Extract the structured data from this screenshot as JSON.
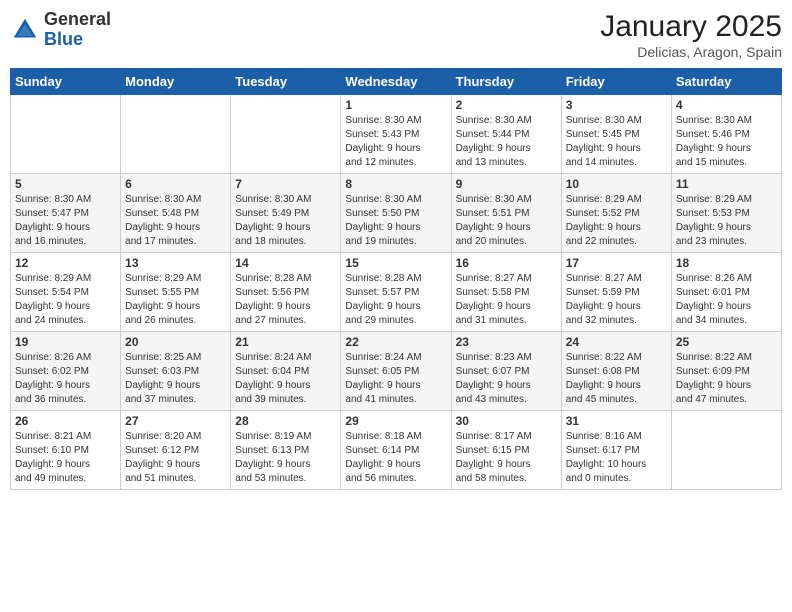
{
  "logo": {
    "general": "General",
    "blue": "Blue"
  },
  "title": "January 2025",
  "location": "Delicias, Aragon, Spain",
  "weekdays": [
    "Sunday",
    "Monday",
    "Tuesday",
    "Wednesday",
    "Thursday",
    "Friday",
    "Saturday"
  ],
  "weeks": [
    [
      {
        "day": "",
        "info": ""
      },
      {
        "day": "",
        "info": ""
      },
      {
        "day": "",
        "info": ""
      },
      {
        "day": "1",
        "info": "Sunrise: 8:30 AM\nSunset: 5:43 PM\nDaylight: 9 hours\nand 12 minutes."
      },
      {
        "day": "2",
        "info": "Sunrise: 8:30 AM\nSunset: 5:44 PM\nDaylight: 9 hours\nand 13 minutes."
      },
      {
        "day": "3",
        "info": "Sunrise: 8:30 AM\nSunset: 5:45 PM\nDaylight: 9 hours\nand 14 minutes."
      },
      {
        "day": "4",
        "info": "Sunrise: 8:30 AM\nSunset: 5:46 PM\nDaylight: 9 hours\nand 15 minutes."
      }
    ],
    [
      {
        "day": "5",
        "info": "Sunrise: 8:30 AM\nSunset: 5:47 PM\nDaylight: 9 hours\nand 16 minutes."
      },
      {
        "day": "6",
        "info": "Sunrise: 8:30 AM\nSunset: 5:48 PM\nDaylight: 9 hours\nand 17 minutes."
      },
      {
        "day": "7",
        "info": "Sunrise: 8:30 AM\nSunset: 5:49 PM\nDaylight: 9 hours\nand 18 minutes."
      },
      {
        "day": "8",
        "info": "Sunrise: 8:30 AM\nSunset: 5:50 PM\nDaylight: 9 hours\nand 19 minutes."
      },
      {
        "day": "9",
        "info": "Sunrise: 8:30 AM\nSunset: 5:51 PM\nDaylight: 9 hours\nand 20 minutes."
      },
      {
        "day": "10",
        "info": "Sunrise: 8:29 AM\nSunset: 5:52 PM\nDaylight: 9 hours\nand 22 minutes."
      },
      {
        "day": "11",
        "info": "Sunrise: 8:29 AM\nSunset: 5:53 PM\nDaylight: 9 hours\nand 23 minutes."
      }
    ],
    [
      {
        "day": "12",
        "info": "Sunrise: 8:29 AM\nSunset: 5:54 PM\nDaylight: 9 hours\nand 24 minutes."
      },
      {
        "day": "13",
        "info": "Sunrise: 8:29 AM\nSunset: 5:55 PM\nDaylight: 9 hours\nand 26 minutes."
      },
      {
        "day": "14",
        "info": "Sunrise: 8:28 AM\nSunset: 5:56 PM\nDaylight: 9 hours\nand 27 minutes."
      },
      {
        "day": "15",
        "info": "Sunrise: 8:28 AM\nSunset: 5:57 PM\nDaylight: 9 hours\nand 29 minutes."
      },
      {
        "day": "16",
        "info": "Sunrise: 8:27 AM\nSunset: 5:58 PM\nDaylight: 9 hours\nand 31 minutes."
      },
      {
        "day": "17",
        "info": "Sunrise: 8:27 AM\nSunset: 5:59 PM\nDaylight: 9 hours\nand 32 minutes."
      },
      {
        "day": "18",
        "info": "Sunrise: 8:26 AM\nSunset: 6:01 PM\nDaylight: 9 hours\nand 34 minutes."
      }
    ],
    [
      {
        "day": "19",
        "info": "Sunrise: 8:26 AM\nSunset: 6:02 PM\nDaylight: 9 hours\nand 36 minutes."
      },
      {
        "day": "20",
        "info": "Sunrise: 8:25 AM\nSunset: 6:03 PM\nDaylight: 9 hours\nand 37 minutes."
      },
      {
        "day": "21",
        "info": "Sunrise: 8:24 AM\nSunset: 6:04 PM\nDaylight: 9 hours\nand 39 minutes."
      },
      {
        "day": "22",
        "info": "Sunrise: 8:24 AM\nSunset: 6:05 PM\nDaylight: 9 hours\nand 41 minutes."
      },
      {
        "day": "23",
        "info": "Sunrise: 8:23 AM\nSunset: 6:07 PM\nDaylight: 9 hours\nand 43 minutes."
      },
      {
        "day": "24",
        "info": "Sunrise: 8:22 AM\nSunset: 6:08 PM\nDaylight: 9 hours\nand 45 minutes."
      },
      {
        "day": "25",
        "info": "Sunrise: 8:22 AM\nSunset: 6:09 PM\nDaylight: 9 hours\nand 47 minutes."
      }
    ],
    [
      {
        "day": "26",
        "info": "Sunrise: 8:21 AM\nSunset: 6:10 PM\nDaylight: 9 hours\nand 49 minutes."
      },
      {
        "day": "27",
        "info": "Sunrise: 8:20 AM\nSunset: 6:12 PM\nDaylight: 9 hours\nand 51 minutes."
      },
      {
        "day": "28",
        "info": "Sunrise: 8:19 AM\nSunset: 6:13 PM\nDaylight: 9 hours\nand 53 minutes."
      },
      {
        "day": "29",
        "info": "Sunrise: 8:18 AM\nSunset: 6:14 PM\nDaylight: 9 hours\nand 56 minutes."
      },
      {
        "day": "30",
        "info": "Sunrise: 8:17 AM\nSunset: 6:15 PM\nDaylight: 9 hours\nand 58 minutes."
      },
      {
        "day": "31",
        "info": "Sunrise: 8:16 AM\nSunset: 6:17 PM\nDaylight: 10 hours\nand 0 minutes."
      },
      {
        "day": "",
        "info": ""
      }
    ]
  ]
}
